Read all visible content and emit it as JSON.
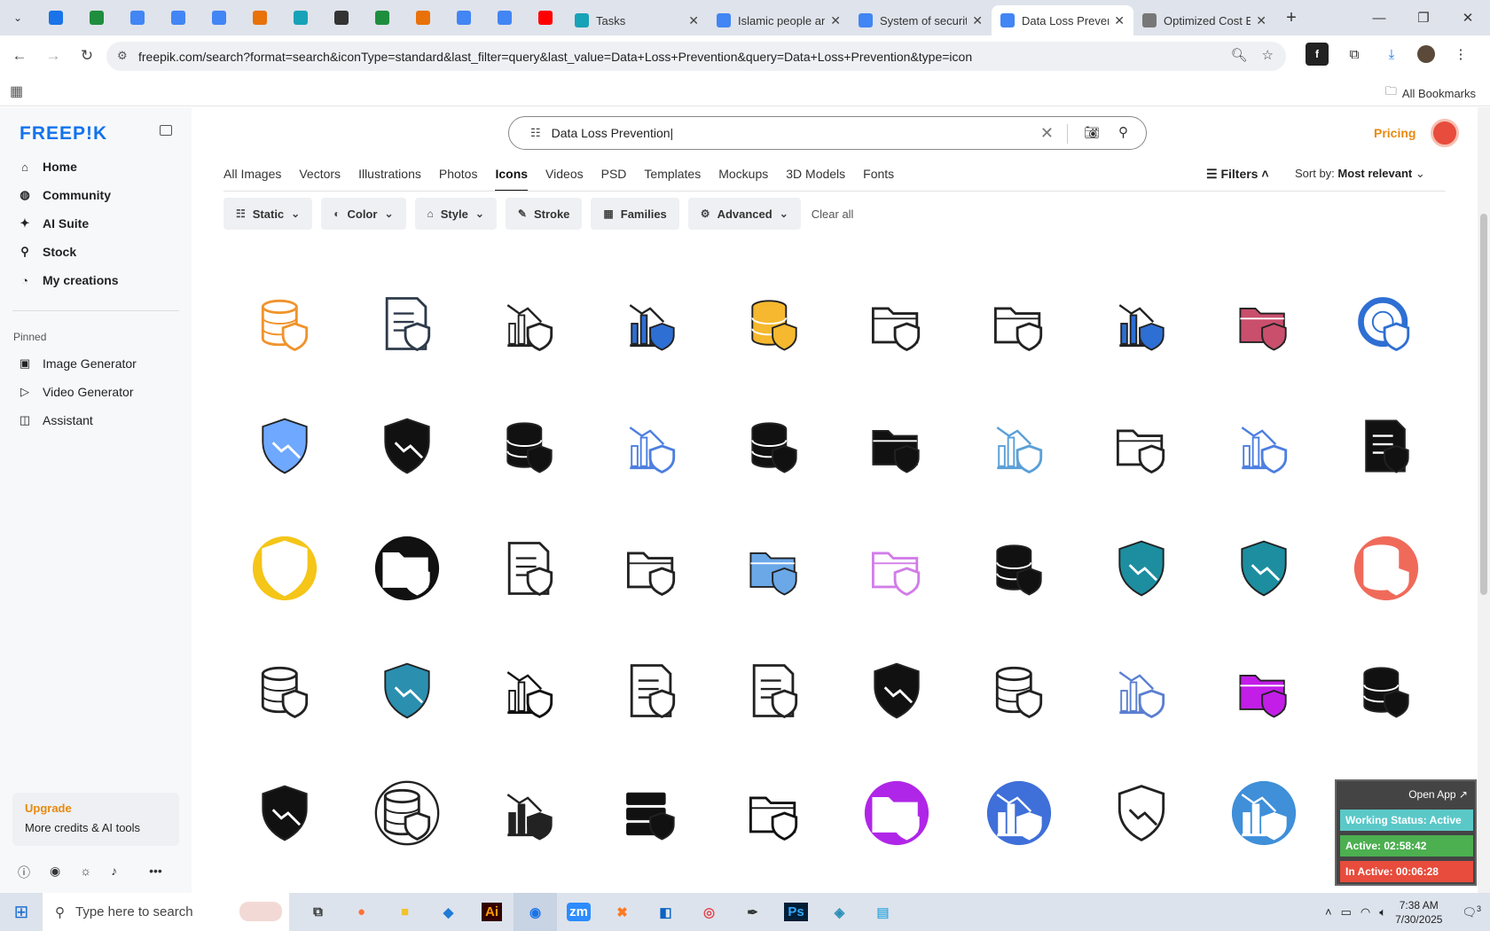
{
  "browser": {
    "tabs": [
      {
        "title": "Tasks",
        "color": "#17a2b8",
        "active": false
      },
      {
        "title": "Islamic people and",
        "color": "#4285f4",
        "active": false
      },
      {
        "title": "System of security",
        "color": "#4285f4",
        "active": false
      },
      {
        "title": "Data Loss Preven",
        "color": "#4285f4",
        "active": true
      },
      {
        "title": "Optimized Cost E",
        "color": "#777777",
        "active": false
      }
    ],
    "pinned_colors": [
      "#1a73e8",
      "#1e8e3e",
      "#4285f4",
      "#4285f4",
      "#4285f4",
      "#e8710a",
      "#17a2b8",
      "#333333",
      "#1e8e3e",
      "#e8710a",
      "#4285f4",
      "#4285f4",
      "#ff0000"
    ],
    "url": "freepik.com/search?format=search&iconType=standard&last_filter=query&last_value=Data+Loss+Prevention&query=Data+Loss+Prevention&type=icon",
    "bookmarks_label": "All Bookmarks"
  },
  "sidebar": {
    "logo": "FREEP!K",
    "nav": [
      {
        "label": "Home",
        "icon": "home-icon"
      },
      {
        "label": "Community",
        "icon": "globe-icon"
      },
      {
        "label": "AI Suite",
        "icon": "sparkle-icon"
      },
      {
        "label": "Stock",
        "icon": "search-icon"
      },
      {
        "label": "My creations",
        "icon": "user-icon"
      }
    ],
    "pinned_label": "Pinned",
    "pinned": [
      {
        "label": "Image Generator",
        "icon": "image-icon"
      },
      {
        "label": "Video Generator",
        "icon": "video-icon"
      },
      {
        "label": "Assistant",
        "icon": "chat-icon"
      }
    ],
    "upgrade_title": "Upgrade",
    "upgrade_text": "More credits & AI tools"
  },
  "search": {
    "value": "Data Loss Prevention"
  },
  "header": {
    "pricing": "Pricing"
  },
  "types": [
    "All Images",
    "Vectors",
    "Illustrations",
    "Photos",
    "Icons",
    "Videos",
    "PSD",
    "Templates",
    "Mockups",
    "3D Models",
    "Fonts"
  ],
  "active_type": "Icons",
  "filters_label": "Filters",
  "sort": {
    "label": "Sort by:",
    "value": "Most relevant"
  },
  "chips": [
    {
      "label": "Static",
      "icon": "stack-icon",
      "dropdown": true
    },
    {
      "label": "Color",
      "icon": "palette-icon",
      "dropdown": true
    },
    {
      "label": "Style",
      "icon": "brush-icon",
      "dropdown": true
    },
    {
      "label": "Stroke",
      "icon": "pen-icon",
      "dropdown": false
    },
    {
      "label": "Families",
      "icon": "grid-icon",
      "dropdown": false
    },
    {
      "label": "Advanced",
      "icon": "gear-icon",
      "dropdown": true
    }
  ],
  "clear_all": "Clear all",
  "icons": [
    [
      "database-hand-icon",
      "#f0932b",
      "line"
    ],
    [
      "file-shield-icon",
      "#2d3a4a",
      "line"
    ],
    [
      "chart-lock-icon",
      "#222222",
      "line"
    ],
    [
      "chart-gear-icon",
      "#2e6fd3",
      "fill"
    ],
    [
      "database-shield-icon",
      "#f5b82e",
      "fill"
    ],
    [
      "folder-lock-icon",
      "#222222",
      "line"
    ],
    [
      "folder-alert-icon",
      "#222222",
      "line"
    ],
    [
      "chart-gear-icon",
      "#2e6fd3",
      "fill"
    ],
    [
      "folder-shield-icon",
      "#c94f6d",
      "fill"
    ],
    [
      "donut-lock-icon",
      "#2e6fd3",
      "line"
    ],
    [
      "shield-database-icon",
      "#6ea8ff",
      "fill"
    ],
    [
      "shield-database-icon",
      "#111111",
      "fill"
    ],
    [
      "database-alert-icon",
      "#111111",
      "fill"
    ],
    [
      "chart-gear-icon",
      "#4d7fe0",
      "line"
    ],
    [
      "database-x-icon",
      "#111111",
      "fill"
    ],
    [
      "folder-shield-icon",
      "#111111",
      "fill"
    ],
    [
      "chart-gear-icon",
      "#5aa0d8",
      "line"
    ],
    [
      "circle-folder-icon",
      "#222222",
      "line"
    ],
    [
      "chart-gear-icon",
      "#4d7fe0",
      "line"
    ],
    [
      "document-shield-icon",
      "#111111",
      "fill"
    ],
    [
      "shield-chart-icon",
      "#f5c518",
      "circle"
    ],
    [
      "folder-lock-icon",
      "#111111",
      "circle"
    ],
    [
      "file-chart-lock-icon",
      "#222222",
      "line"
    ],
    [
      "folder-shield-icon",
      "#222222",
      "line"
    ],
    [
      "folder-lock-icon",
      "#6aa8e8",
      "fill"
    ],
    [
      "folder-lock-icon",
      "#d17de8",
      "line"
    ],
    [
      "database-x-icon",
      "#111111",
      "fill"
    ],
    [
      "shield-chart-icon",
      "#1c8ea0",
      "fill"
    ],
    [
      "shield-chart-icon",
      "#1c8ea0",
      "fill"
    ],
    [
      "database-shield-icon",
      "#f06a5a",
      "circle"
    ],
    [
      "database-x-icon",
      "#222222",
      "line"
    ],
    [
      "shield-database-icon",
      "#2b8fb0",
      "fill"
    ],
    [
      "chart-gear-icon",
      "#111111",
      "line"
    ],
    [
      "file-chart-lock-icon",
      "#222222",
      "line"
    ],
    [
      "file-shield-icon",
      "#222222",
      "line"
    ],
    [
      "shield-chart-icon",
      "#111111",
      "fill"
    ],
    [
      "database-x-icon",
      "#222222",
      "line"
    ],
    [
      "chart-gear-icon",
      "#5b7fd0",
      "line"
    ],
    [
      "folder-lock-icon",
      "#c21ee8",
      "fill"
    ],
    [
      "database-x-icon",
      "#111111",
      "fill"
    ],
    [
      "shield-chart-icon",
      "#111111",
      "fill"
    ],
    [
      "database-alert-icon",
      "#222222",
      "circle-line"
    ],
    [
      "chart-lock-icon",
      "#222222",
      "fill"
    ],
    [
      "server-x-icon",
      "#111111",
      "fill"
    ],
    [
      "folder-alert-icon",
      "#111111",
      "line"
    ],
    [
      "folder-lock-icon",
      "#b026e8",
      "circle"
    ],
    [
      "chart-gear-icon",
      "#3f6fd9",
      "circle"
    ],
    [
      "shield-chart-icon",
      "#222222",
      "line"
    ],
    [
      "chart-gear-icon",
      "#3f8fd9",
      "circle"
    ],
    [
      "database-shield-icon",
      "#555555",
      "line"
    ]
  ],
  "tracker": {
    "open_app": "Open App ↗",
    "working": "Working Status: Active",
    "active": "Active: 02:58:42",
    "inactive": "In Active: 00:06:28"
  },
  "taskbar": {
    "search_placeholder": "Type here to search",
    "time": "7:38 AM",
    "date": "7/30/2025",
    "notif_count": "3",
    "apps": [
      {
        "name": "task-view-icon",
        "glyph": "⧉",
        "color": "#333"
      },
      {
        "name": "firefox-icon",
        "glyph": "●",
        "color": "#ff7139"
      },
      {
        "name": "file-explorer-icon",
        "glyph": "■",
        "color": "#f2c12e"
      },
      {
        "name": "vscode-icon",
        "glyph": "◆",
        "color": "#1f7bd6"
      },
      {
        "name": "illustrator-icon",
        "glyph": "Ai",
        "color": "#ff9a00"
      },
      {
        "name": "chrome-icon",
        "glyph": "◉",
        "color": "#1a73e8"
      },
      {
        "name": "zoom-icon",
        "glyph": "zm",
        "color": "#fff"
      },
      {
        "name": "xampp-icon",
        "glyph": "✖",
        "color": "#fb7a24"
      },
      {
        "name": "outlook-icon",
        "glyph": "◧",
        "color": "#0a64c2"
      },
      {
        "name": "creative-cloud-icon",
        "glyph": "◎",
        "color": "#e34850"
      },
      {
        "name": "pen-tool-icon",
        "glyph": "✒",
        "color": "#333"
      },
      {
        "name": "photoshop-icon",
        "glyph": "Ps",
        "color": "#31a8ff"
      },
      {
        "name": "app-icon",
        "glyph": "◈",
        "color": "#2a8fb8"
      },
      {
        "name": "notepad-icon",
        "glyph": "▤",
        "color": "#4ab0e0"
      }
    ]
  }
}
